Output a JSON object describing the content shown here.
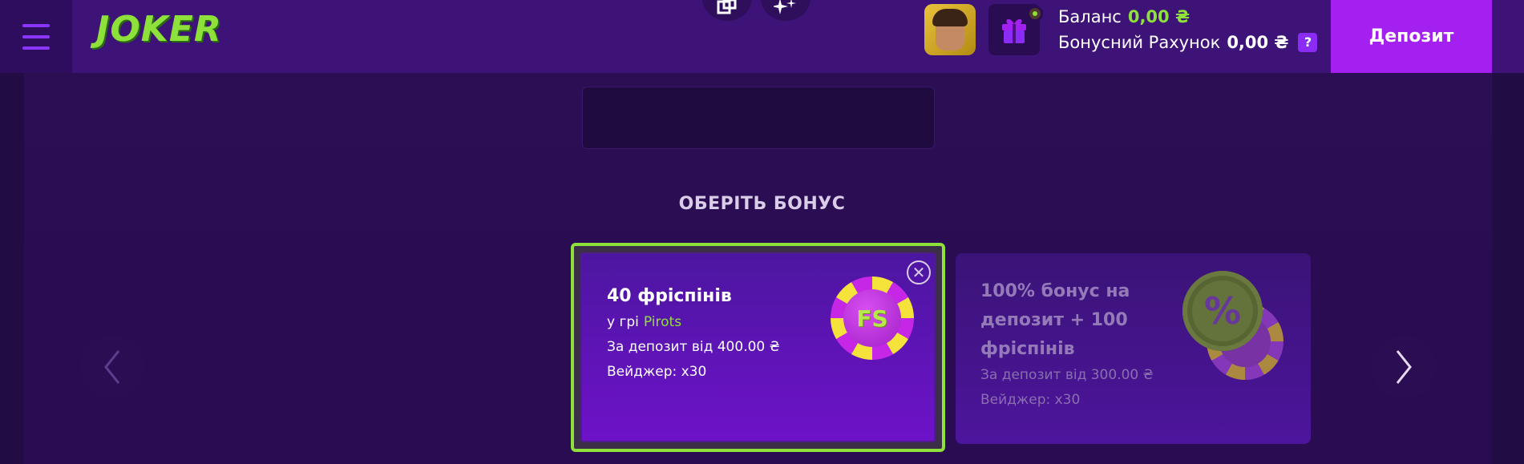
{
  "header": {
    "logo_text": "JOKER",
    "balance_label": "Баланс",
    "balance_value": "0,00 ₴",
    "bonus_label": "Бонусний Рахунок",
    "bonus_value": "0,00 ₴",
    "help_label": "?",
    "deposit_label": "Депозит"
  },
  "main": {
    "section_title": "ОБЕРІТЬ БОНУС",
    "cards": [
      {
        "title": "40 фріспінів",
        "game_prefix": "у грі",
        "game_name": "Pirots",
        "deposit_text": "За депозит від 400.00 ₴",
        "wager_text": "Вейджер: x30",
        "badge": "FS",
        "close_icon": "✕"
      },
      {
        "title_lines": [
          "100% бонус на",
          "депозит + 100",
          "фріспінів"
        ],
        "deposit_text": "За депозит від 300.00 ₴",
        "wager_text": "Вейджер: x30",
        "badge": "%"
      }
    ]
  },
  "colors": {
    "accent_green": "#8ee03a",
    "deposit_purple": "#a320f0",
    "header_purple": "#3e1378"
  }
}
